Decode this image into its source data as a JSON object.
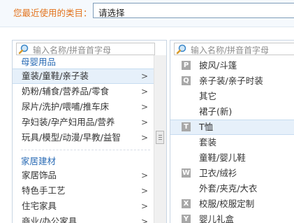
{
  "recent": {
    "label": "您最近使用的类目：",
    "value": "请选择"
  },
  "left_panel": {
    "search_placeholder": "输入名称/拼音首字母",
    "group1_title": "母婴用品",
    "group1_items": [
      {
        "label": "童装/童鞋/亲子装",
        "chevron": ">"
      },
      {
        "label": "奶粉/辅食/营养品/零食",
        "chevron": ">"
      },
      {
        "label": "尿片/洗护/喂哺/推车床",
        "chevron": ">"
      },
      {
        "label": "孕妇装/孕产妇用品/营养",
        "chevron": ">"
      },
      {
        "label": "玩具/模型/动漫/早教/益智",
        "chevron": ">"
      }
    ],
    "group2_title": "家居建材",
    "group2_items": [
      {
        "label": "家居饰品",
        "chevron": ">"
      },
      {
        "label": "特色手工艺",
        "chevron": ">"
      },
      {
        "label": "住宅家具",
        "chevron": ">"
      },
      {
        "label": "商业/办公家具",
        "chevron": ">"
      }
    ]
  },
  "right_panel": {
    "search_placeholder": "输入名称/拼音首字母",
    "items": [
      {
        "letter": "P",
        "label": "披风/斗篷"
      },
      {
        "letter": "Q",
        "label": "亲子装/亲子时装"
      },
      {
        "letter": "",
        "label": "其它"
      },
      {
        "letter": "",
        "label": "裙子(新)"
      },
      {
        "letter": "T",
        "label": "T恤"
      },
      {
        "letter": "",
        "label": "套装"
      },
      {
        "letter": "",
        "label": "童鞋/婴儿鞋"
      },
      {
        "letter": "W",
        "label": "卫衣/绒衫"
      },
      {
        "letter": "",
        "label": "外套/夹克/大衣"
      },
      {
        "letter": "X",
        "label": "校服/校服定制"
      },
      {
        "letter": "Y",
        "label": "婴儿礼盒"
      }
    ]
  },
  "colors": {
    "accent": "#2b6cb5",
    "label_orange": "#e3731c",
    "selected_bg": "#e6f0fa"
  }
}
